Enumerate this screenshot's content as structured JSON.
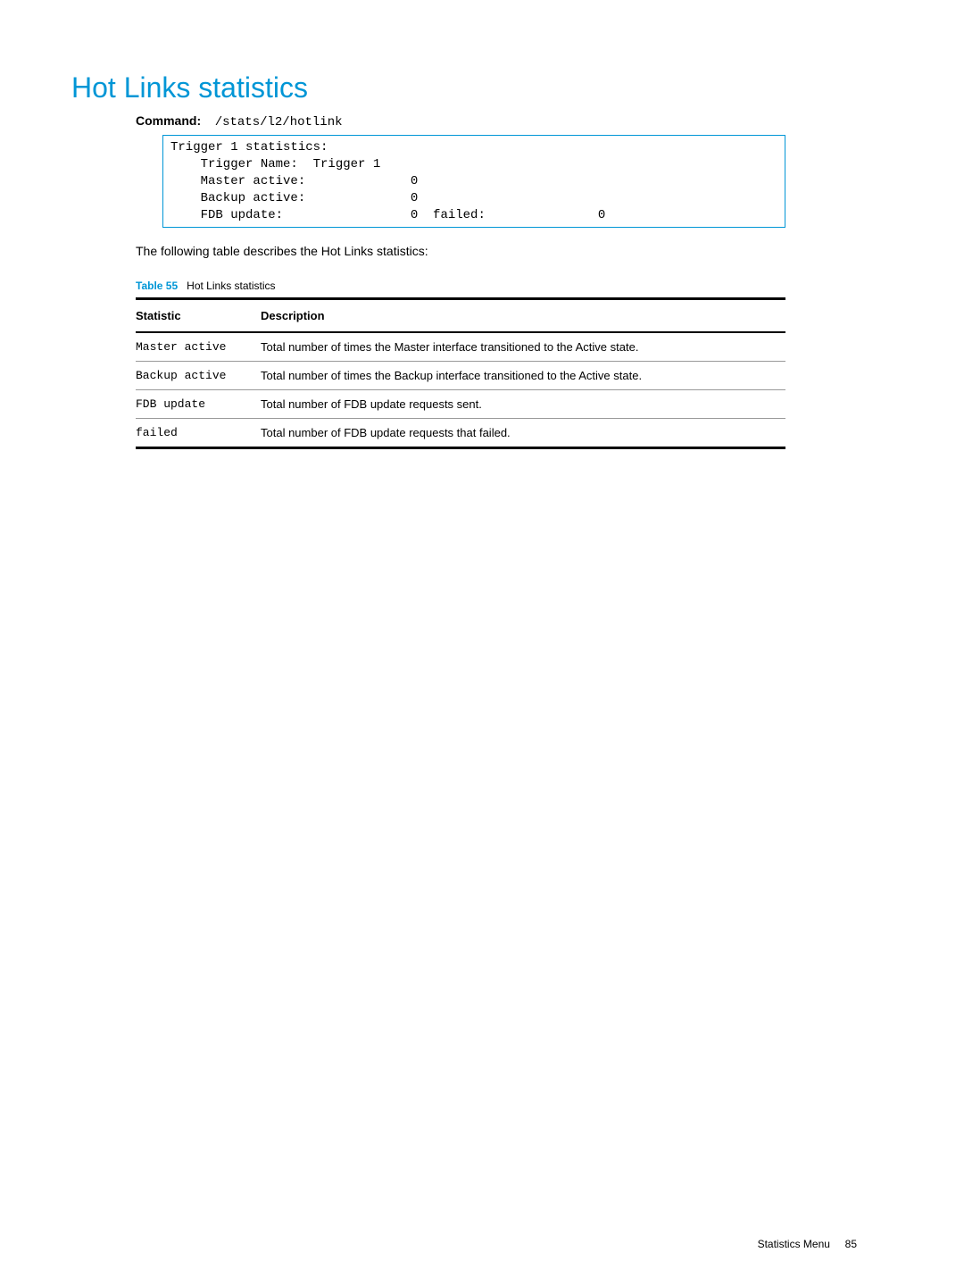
{
  "page": {
    "title": "Hot Links statistics",
    "command_label": "Command:",
    "command_path": "/stats/l2/hotlink",
    "code_block": "Trigger 1 statistics:\n    Trigger Name:  Trigger 1\n    Master active:              0\n    Backup active:              0\n    FDB update:                 0  failed:               0",
    "description": "The following table describes the Hot Links statistics:",
    "table_caption_label": "Table 55",
    "table_caption_text": "Hot Links statistics",
    "table_headers": {
      "statistic": "Statistic",
      "description": "Description"
    },
    "table_rows": [
      {
        "statistic": "Master active",
        "description": "Total number of times the Master interface transitioned to the Active state."
      },
      {
        "statistic": "Backup active",
        "description": "Total number of times the Backup interface transitioned to the Active state."
      },
      {
        "statistic": "FDB update",
        "description": "Total number of FDB update requests sent."
      },
      {
        "statistic": "failed",
        "description": "Total number of FDB update requests that failed."
      }
    ],
    "footer_text": "Statistics Menu",
    "footer_page": "85"
  }
}
